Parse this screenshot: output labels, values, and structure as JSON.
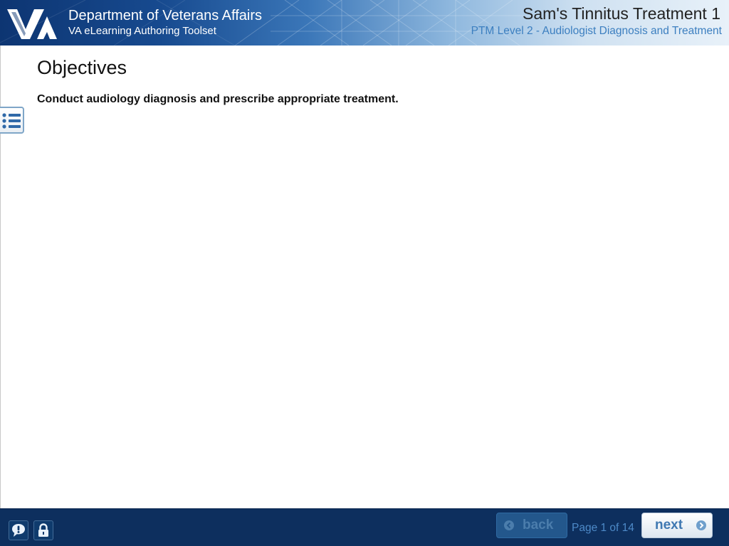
{
  "header": {
    "organization": "Department of Veterans Affairs",
    "toolset": "VA eLearning Authoring Toolset",
    "course_title": "Sam's Tinnitus Treatment 1",
    "course_subtitle": "PTM Level 2 - Audiologist Diagnosis and Treatment",
    "logo_icon": "va-logo"
  },
  "main": {
    "heading": "Objectives",
    "objective": "Conduct audiology diagnosis and prescribe appropriate treatment.",
    "toc_icon": "list-icon"
  },
  "footer": {
    "help_icon": "help-icon",
    "lock_icon": "lock-icon",
    "back_label": "back",
    "next_label": "next",
    "page_counter": "Page 1 of 14",
    "back_enabled": false
  },
  "colors": {
    "header_dark": "#0d3572",
    "header_light": "#e8f1f9",
    "footer_bg": "#0d2f5e",
    "accent": "#3c7fc0"
  }
}
